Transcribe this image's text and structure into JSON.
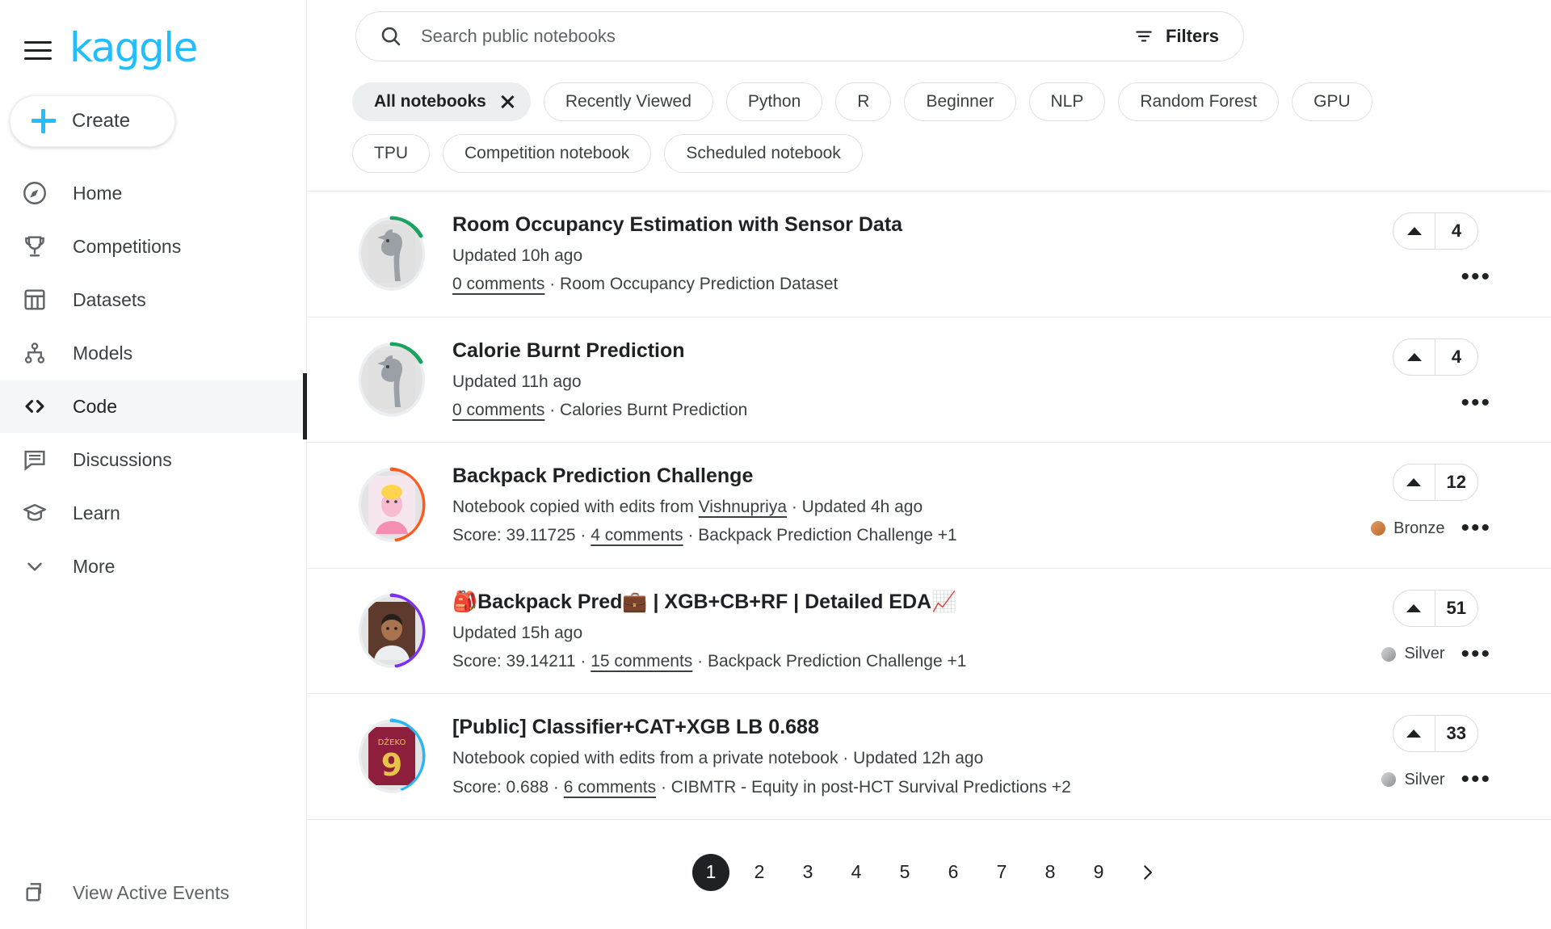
{
  "brand": {
    "logo_text": "kaggle",
    "accent_color": "#20beff"
  },
  "sidebar": {
    "create_label": "Create",
    "items": [
      {
        "label": "Home",
        "icon": "compass-icon",
        "active": false
      },
      {
        "label": "Competitions",
        "icon": "trophy-icon",
        "active": false
      },
      {
        "label": "Datasets",
        "icon": "table-icon",
        "active": false
      },
      {
        "label": "Models",
        "icon": "model-tree-icon",
        "active": false
      },
      {
        "label": "Code",
        "icon": "code-brackets-icon",
        "active": true
      },
      {
        "label": "Discussions",
        "icon": "comment-icon",
        "active": false
      },
      {
        "label": "Learn",
        "icon": "graduation-cap-icon",
        "active": false
      },
      {
        "label": "More",
        "icon": "chevron-down-icon",
        "active": false
      }
    ],
    "footer": {
      "label": "View Active Events",
      "icon": "stacked-squares-icon"
    }
  },
  "search": {
    "placeholder": "Search public notebooks",
    "value": "",
    "filters_label": "Filters"
  },
  "chips": [
    {
      "label": "All notebooks",
      "active": true,
      "removable": true
    },
    {
      "label": "Recently Viewed",
      "active": false,
      "removable": false
    },
    {
      "label": "Python",
      "active": false,
      "removable": false
    },
    {
      "label": "R",
      "active": false,
      "removable": false
    },
    {
      "label": "Beginner",
      "active": false,
      "removable": false
    },
    {
      "label": "NLP",
      "active": false,
      "removable": false
    },
    {
      "label": "Random Forest",
      "active": false,
      "removable": false
    },
    {
      "label": "GPU",
      "active": false,
      "removable": false
    },
    {
      "label": "TPU",
      "active": false,
      "removable": false
    },
    {
      "label": "Competition notebook",
      "active": false,
      "removable": false
    },
    {
      "label": "Scheduled notebook",
      "active": false,
      "removable": false
    }
  ],
  "notebooks": [
    {
      "title": "Room Occupancy Estimation with Sensor Data",
      "subtitle": "Updated 10h ago",
      "meta_prefix": "",
      "comments": "0 comments",
      "meta_suffix": " · Room Occupancy Prediction Dataset",
      "votes": "4",
      "medal": "",
      "avatar": "goose",
      "ring_color": "#1aa260",
      "ring_pct": 25
    },
    {
      "title": "Calorie Burnt Prediction",
      "subtitle": "Updated 11h ago",
      "meta_prefix": "",
      "comments": "0 comments",
      "meta_suffix": " · Calories Burnt Prediction",
      "votes": "4",
      "medal": "",
      "avatar": "goose",
      "ring_color": "#1aa260",
      "ring_pct": 25
    },
    {
      "title": "Backpack Prediction Challenge",
      "subtitle_before_link": "Notebook copied with edits from ",
      "subtitle_link": "Vishnupriya",
      "subtitle_after_link": " · Updated 4h ago",
      "meta_prefix": "Score: 39.11725 · ",
      "comments": "4 comments",
      "meta_suffix": " · Backpack Prediction Challenge +1",
      "votes": "12",
      "medal": "Bronze",
      "avatar": "peach",
      "ring_color": "#ff5b1f",
      "ring_pct": 62
    },
    {
      "title": "🎒Backpack Pred💼 | XGB+CB+RF | Detailed EDA📈",
      "subtitle": "Updated 15h ago",
      "meta_prefix": "Score: 39.14211 · ",
      "comments": "15 comments",
      "meta_suffix": " · Backpack Prediction Challenge +1",
      "votes": "51",
      "medal": "Silver",
      "avatar": "man",
      "ring_color": "#7b2ff7",
      "ring_pct": 62
    },
    {
      "title": "[Public] Classifier+CAT+XGB LB 0.688",
      "subtitle": "Notebook copied with edits from a private notebook · Updated 12h ago",
      "meta_prefix": "Score: 0.688 · ",
      "comments": "6 comments",
      "meta_suffix": " · CIBMTR - Equity in post-HCT Survival Predictions +2",
      "votes": "33",
      "medal": "Silver",
      "avatar": "jersey",
      "ring_color": "#29b6f6",
      "ring_pct": 55
    }
  ],
  "pagination": {
    "pages": [
      "1",
      "2",
      "3",
      "4",
      "5",
      "6",
      "7",
      "8",
      "9"
    ],
    "current": "1",
    "next_icon": "chevron-right-icon"
  }
}
